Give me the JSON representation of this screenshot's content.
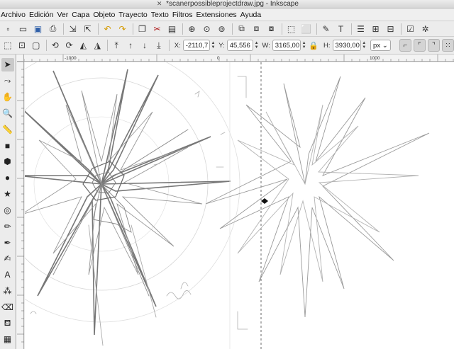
{
  "window": {
    "title": "*scanerpossibleprojectdraw.jpg - Inkscape"
  },
  "menu": [
    "Archivo",
    "Edición",
    "Ver",
    "Capa",
    "Objeto",
    "Trayecto",
    "Texto",
    "Filtros",
    "Extensiones",
    "Ayuda"
  ],
  "commands": [
    {
      "name": "new-document-icon",
      "glyph": "▫"
    },
    {
      "name": "open-file-icon",
      "glyph": "▭"
    },
    {
      "name": "save-icon",
      "glyph": "▣"
    },
    {
      "name": "print-icon",
      "glyph": "⎙"
    },
    {
      "name": "import-icon",
      "glyph": "⇲"
    },
    {
      "name": "export-icon",
      "glyph": "⇱"
    },
    {
      "name": "undo-icon",
      "glyph": "↶"
    },
    {
      "name": "redo-icon",
      "glyph": "↷"
    },
    {
      "name": "copy-icon",
      "glyph": "❐"
    },
    {
      "name": "cut-icon",
      "glyph": "✂"
    },
    {
      "name": "paste-icon",
      "glyph": "▤"
    },
    {
      "name": "zoom-selection-icon",
      "glyph": "⊕"
    },
    {
      "name": "zoom-drawing-icon",
      "glyph": "⊙"
    },
    {
      "name": "zoom-page-icon",
      "glyph": "⊚"
    },
    {
      "name": "duplicate-icon",
      "glyph": "⧉"
    },
    {
      "name": "clone-icon",
      "glyph": "⧈"
    },
    {
      "name": "unlink-clone-icon",
      "glyph": "⧇"
    },
    {
      "name": "group-icon",
      "glyph": "⬚"
    },
    {
      "name": "ungroup-icon",
      "glyph": "⬜"
    },
    {
      "name": "fill-stroke-icon",
      "glyph": "✎"
    },
    {
      "name": "text-font-icon",
      "glyph": "T"
    },
    {
      "name": "layers-icon",
      "glyph": "☰"
    },
    {
      "name": "xml-editor-icon",
      "glyph": "⊞"
    },
    {
      "name": "align-distribute-icon",
      "glyph": "⊟"
    },
    {
      "name": "document-properties-icon",
      "glyph": "☑"
    },
    {
      "name": "preferences-icon",
      "glyph": "✲"
    }
  ],
  "controls": {
    "x_label": "X:",
    "x_value": "-2110,7",
    "y_label": "Y:",
    "y_value": "45,556",
    "w_label": "W:",
    "w_value": "3165,00",
    "h_label": "H:",
    "h_value": "3930,00",
    "unit": "px"
  },
  "tools": [
    {
      "name": "selector-tool-icon",
      "glyph": "➤",
      "active": true
    },
    {
      "name": "node-tool-icon",
      "glyph": "⤳",
      "active": false
    },
    {
      "name": "tweak-tool-icon",
      "glyph": "✋",
      "active": false
    },
    {
      "name": "zoom-tool-icon",
      "glyph": "🔍",
      "active": false
    },
    {
      "name": "measure-tool-icon",
      "glyph": "📏",
      "active": false
    },
    {
      "name": "rectangle-tool-icon",
      "glyph": "■",
      "active": false
    },
    {
      "name": "box3d-tool-icon",
      "glyph": "⬢",
      "active": false
    },
    {
      "name": "ellipse-tool-icon",
      "glyph": "●",
      "active": false
    },
    {
      "name": "star-tool-icon",
      "glyph": "★",
      "active": false
    },
    {
      "name": "spiral-tool-icon",
      "glyph": "◎",
      "active": false
    },
    {
      "name": "pencil-tool-icon",
      "glyph": "✏",
      "active": false
    },
    {
      "name": "pen-tool-icon",
      "glyph": "✒",
      "active": false
    },
    {
      "name": "calligraphy-tool-icon",
      "glyph": "✍",
      "active": false
    },
    {
      "name": "text-tool-icon",
      "glyph": "A",
      "active": false
    },
    {
      "name": "spray-tool-icon",
      "glyph": "⁂",
      "active": false
    },
    {
      "name": "eraser-tool-icon",
      "glyph": "⌫",
      "active": false
    },
    {
      "name": "paint-bucket-tool-icon",
      "glyph": "⛾",
      "active": false
    },
    {
      "name": "gradient-tool-icon",
      "glyph": "▦",
      "active": false
    }
  ],
  "rulers": {
    "h_labels": [
      "-1000",
      "0",
      "1000"
    ]
  },
  "colors": {
    "accent": "#3a6ea5",
    "sketch": "#555555"
  }
}
